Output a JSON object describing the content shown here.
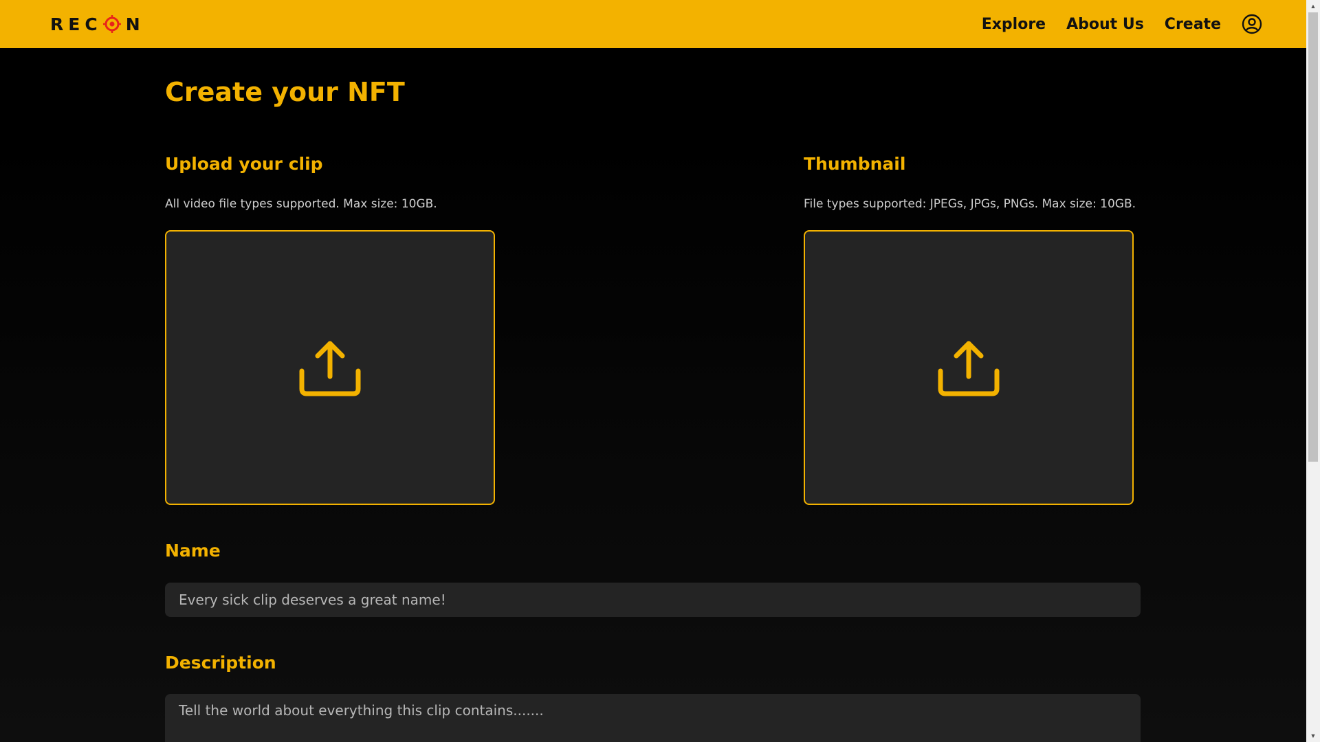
{
  "header": {
    "logo_text": "REC N",
    "logo_left": "REC",
    "logo_right": "N",
    "nav": {
      "explore": "Explore",
      "about": "About Us",
      "create": "Create"
    }
  },
  "page": {
    "title": "Create your NFT"
  },
  "upload_clip": {
    "label": "Upload your clip",
    "hint": "All video file types supported. Max size: 10GB."
  },
  "thumbnail": {
    "label": "Thumbnail",
    "hint": "File types supported: JPEGs, JPGs, PNGs. Max size: 10GB."
  },
  "name_field": {
    "label": "Name",
    "placeholder": "Every sick clip deserves a great name!"
  },
  "description_field": {
    "label": "Description",
    "placeholder": "Tell the world about everything this clip contains......."
  },
  "colors": {
    "accent": "#f3b200",
    "logo_target": "#e8231a",
    "background": "#000000",
    "field_bg": "#242424"
  },
  "icons": {
    "logo": "crosshair-target-icon",
    "profile": "user-circle-icon",
    "upload": "upload-arrow-icon"
  }
}
